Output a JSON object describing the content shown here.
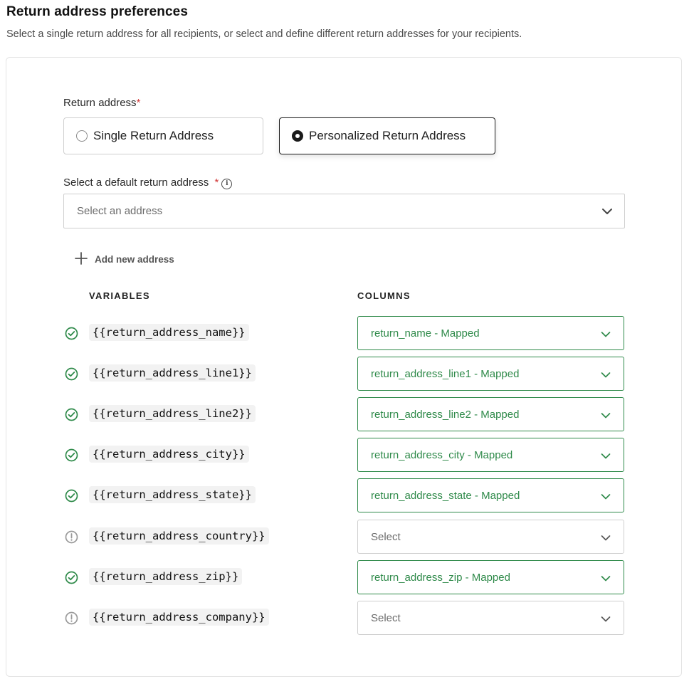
{
  "header": {
    "title": "Return address preferences",
    "subtitle": "Select a single return address for all recipients, or select and define different return addresses for your recipients."
  },
  "return_address": {
    "label": "Return address",
    "required_mark": "*",
    "options": [
      {
        "label": "Single Return Address",
        "selected": false
      },
      {
        "label": "Personalized Return Address",
        "selected": true
      }
    ]
  },
  "default_address": {
    "label": "Select a default return address",
    "required_mark": "*",
    "info_icon": "info-icon",
    "placeholder": "Select an address",
    "chevron_icon": "chevron-down-icon"
  },
  "add_new": {
    "label": "Add new address",
    "icon": "plus-icon"
  },
  "mapping": {
    "variables_header": "VARIABLES",
    "columns_header": "COLUMNS",
    "colors": {
      "mapped": "#2f8a4a",
      "unmapped_icon": "#9a9a9a"
    },
    "rows": [
      {
        "variable": "{{return_address_name}}",
        "status": "mapped",
        "column": "return_name - Mapped"
      },
      {
        "variable": "{{return_address_line1}}",
        "status": "mapped",
        "column": "return_address_line1 - Mapped"
      },
      {
        "variable": "{{return_address_line2}}",
        "status": "mapped",
        "column": "return_address_line2 - Mapped"
      },
      {
        "variable": "{{return_address_city}}",
        "status": "mapped",
        "column": "return_address_city - Mapped"
      },
      {
        "variable": "{{return_address_state}}",
        "status": "mapped",
        "column": "return_address_state - Mapped"
      },
      {
        "variable": "{{return_address_country}}",
        "status": "unmapped",
        "column": "Select"
      },
      {
        "variable": "{{return_address_zip}}",
        "status": "mapped",
        "column": "return_address_zip - Mapped"
      },
      {
        "variable": "{{return_address_company}}",
        "status": "unmapped",
        "column": "Select"
      }
    ]
  }
}
